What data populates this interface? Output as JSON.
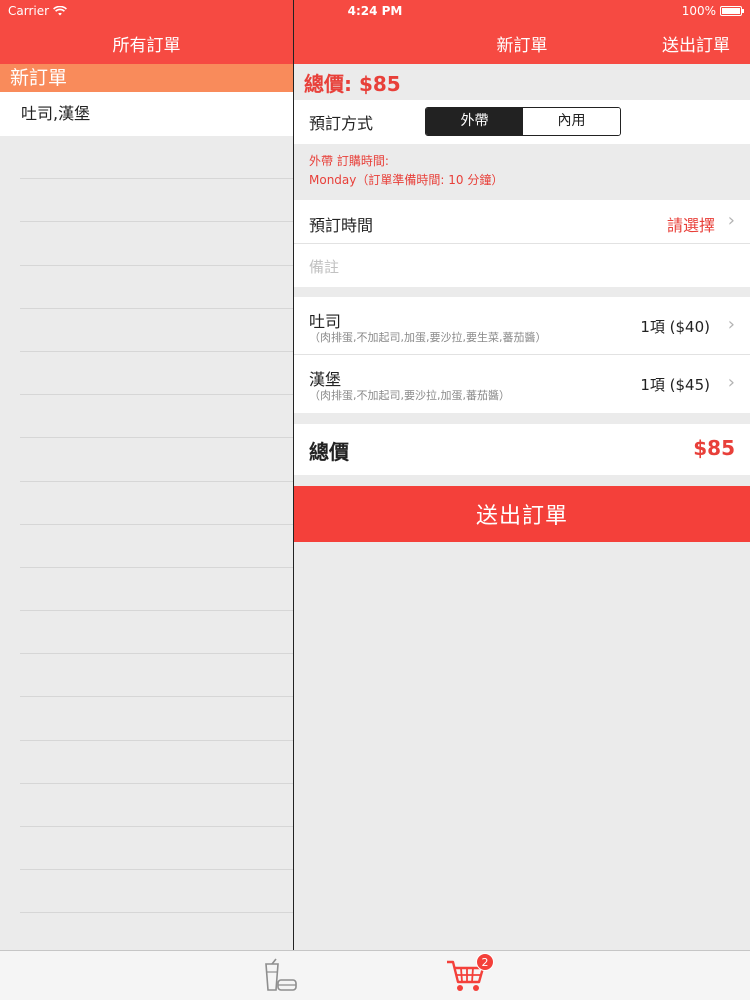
{
  "status_bar": {
    "carrier": "Carrier",
    "time": "4:24 PM",
    "battery": "100%"
  },
  "left": {
    "nav_title": "所有訂單",
    "section_header": "新訂單",
    "orders": [
      {
        "label": "吐司,漢堡"
      }
    ]
  },
  "right": {
    "nav_title": "新訂單",
    "nav_action": "送出訂單",
    "total_top": "總價: $85",
    "order_type": {
      "label": "預訂方式",
      "options": [
        "外帶",
        "內用"
      ],
      "selected": "外帶"
    },
    "info": {
      "line1": "外帶 訂購時間:",
      "line2": "Monday（訂單準備時間: 10 分鐘）"
    },
    "time_row": {
      "label": "預訂時間",
      "value": "請選擇"
    },
    "note": {
      "placeholder": "備註"
    },
    "items": [
      {
        "name": "吐司",
        "options": "（肉排蛋,不加起司,加蛋,要沙拉,要生菜,蕃茄醬）",
        "qty": "1項 ($40)"
      },
      {
        "name": "漢堡",
        "options": "（肉排蛋,不加起司,要沙拉,加蛋,蕃茄醬）",
        "qty": "1項 ($45)"
      }
    ],
    "total": {
      "label": "總價",
      "amount": "$85"
    },
    "submit_label": "送出訂單"
  },
  "tab_bar": {
    "tabs": [
      {
        "icon": "drink-food-icon",
        "selected": false
      },
      {
        "icon": "shopping-cart-icon",
        "selected": true,
        "badge": "2"
      }
    ]
  },
  "colors": {
    "accent": "#f64a42",
    "section_header": "#f98b5b",
    "text_red": "#e8403a"
  }
}
